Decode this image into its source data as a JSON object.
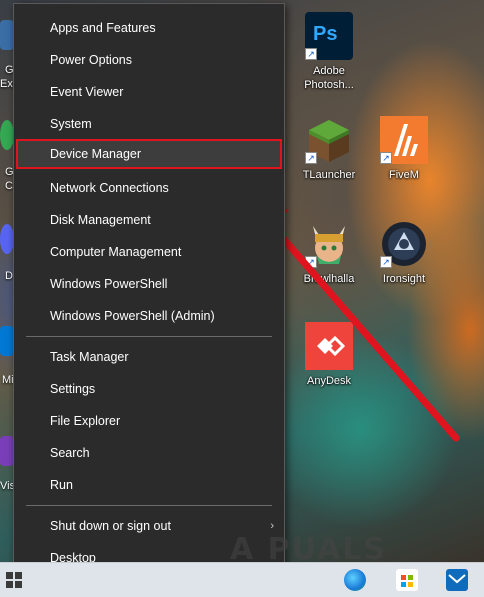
{
  "menu": {
    "items_group1": [
      {
        "label": "Apps and Features"
      },
      {
        "label": "Power Options"
      },
      {
        "label": "Event Viewer"
      },
      {
        "label": "System"
      },
      {
        "label": "Device Manager"
      },
      {
        "label": "Network Connections"
      },
      {
        "label": "Disk Management"
      },
      {
        "label": "Computer Management"
      },
      {
        "label": "Windows PowerShell"
      },
      {
        "label": "Windows PowerShell (Admin)"
      }
    ],
    "items_group2": [
      {
        "label": "Task Manager"
      },
      {
        "label": "Settings"
      },
      {
        "label": "File Explorer"
      },
      {
        "label": "Search"
      },
      {
        "label": "Run"
      }
    ],
    "items_group3": [
      {
        "label": "Shut down or sign out"
      },
      {
        "label": "Desktop"
      }
    ],
    "highlighted": "Device Manager"
  },
  "desktop_icons": [
    {
      "label": "Adobe\nPhotosh...",
      "icon": "photoshop-icon"
    },
    {
      "label": "TLauncher",
      "icon": "minecraft-grass-block-icon"
    },
    {
      "label": "FiveM",
      "icon": "fivem-icon"
    },
    {
      "label": "Brawlhalla",
      "icon": "brawlhalla-icon"
    },
    {
      "label": "Ironsight",
      "icon": "ironsight-icon"
    },
    {
      "label": "AnyDesk",
      "icon": "anydesk-icon"
    }
  ],
  "edge_labels": [
    "G",
    "Exp",
    "G",
    "C",
    "D",
    "Mi",
    "Visu"
  ],
  "watermark": "A PUALS",
  "colors": {
    "highlight_border": "#e0141e",
    "arrow": "#e0141e",
    "menu_bg": "#2b2b2b"
  }
}
